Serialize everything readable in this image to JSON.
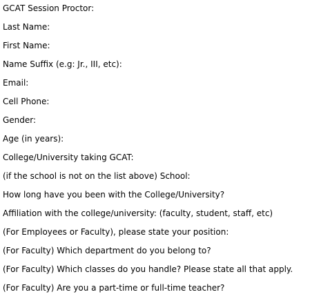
{
  "form": {
    "labels": [
      "GCAT Session Proctor:",
      "Last Name:",
      "First Name:",
      "Name Suffix (e.g: Jr., III, etc):",
      "Email:",
      "Cell Phone:",
      "Gender:",
      "Age (in years):",
      "College/University taking GCAT:",
      "(if the school is not on the list above) School:",
      "How long have you been with the College/University?",
      "Affiliation with the college/university: (faculty, student, staff, etc)",
      "(For Employees or Faculty), please state your position:",
      "(For Faculty) Which department do you belong to?",
      "(For Faculty) Which classes do you handle? Please state all that apply.",
      "(For Faculty) Are you a part-time or full-time teacher?"
    ]
  }
}
